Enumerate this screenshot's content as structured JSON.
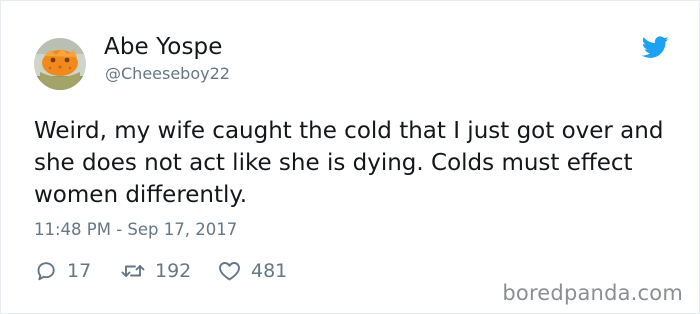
{
  "user": {
    "display_name": "Abe Yospe",
    "handle": "@Cheeseboy22"
  },
  "tweet": {
    "text": "Weird, my wife caught the cold that I just got over and she does not act like she is dying. Colds must effect women differently.",
    "timestamp": "11:48 PM - Sep 17, 2017"
  },
  "actions": {
    "replies": "17",
    "retweets": "192",
    "likes": "481"
  },
  "icons": {
    "brand": "twitter-bird-icon",
    "reply": "reply-icon",
    "retweet": "retweet-icon",
    "like": "heart-icon"
  },
  "colors": {
    "twitter_blue": "#1da1f2",
    "text_primary": "#14171a",
    "text_secondary": "#657786",
    "avatar_orange": "#f08a1e"
  },
  "watermark": "boredpanda.com"
}
